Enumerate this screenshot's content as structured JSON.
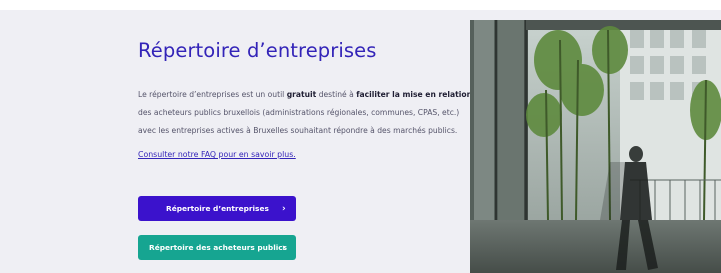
{
  "intro": {
    "title": "Répertoire d’entreprises",
    "desc": {
      "p1": "Le répertoire d’entreprises est un outil ",
      "b1": "gratuit",
      "p2": " destiné à ",
      "b2": "faciliter la mise en relation",
      "p3": " des acheteurs publics bruxellois (administrations régionales, communes, CPAS, etc.) avec les entreprises actives à Bruxelles souhaitant répondre à des marchés publics."
    },
    "faq_link": "Consulter notre FAQ pour en savoir plus.",
    "chevron": "›"
  },
  "buttons": {
    "primary": "Répertoire d’entreprises",
    "secondary": "Répertoire des acheteurs publics"
  },
  "colors": {
    "accent": "#3324b8",
    "primary_button": "#3b12cc",
    "secondary_button": "#16a591",
    "banner_bg": "#efeff4"
  }
}
